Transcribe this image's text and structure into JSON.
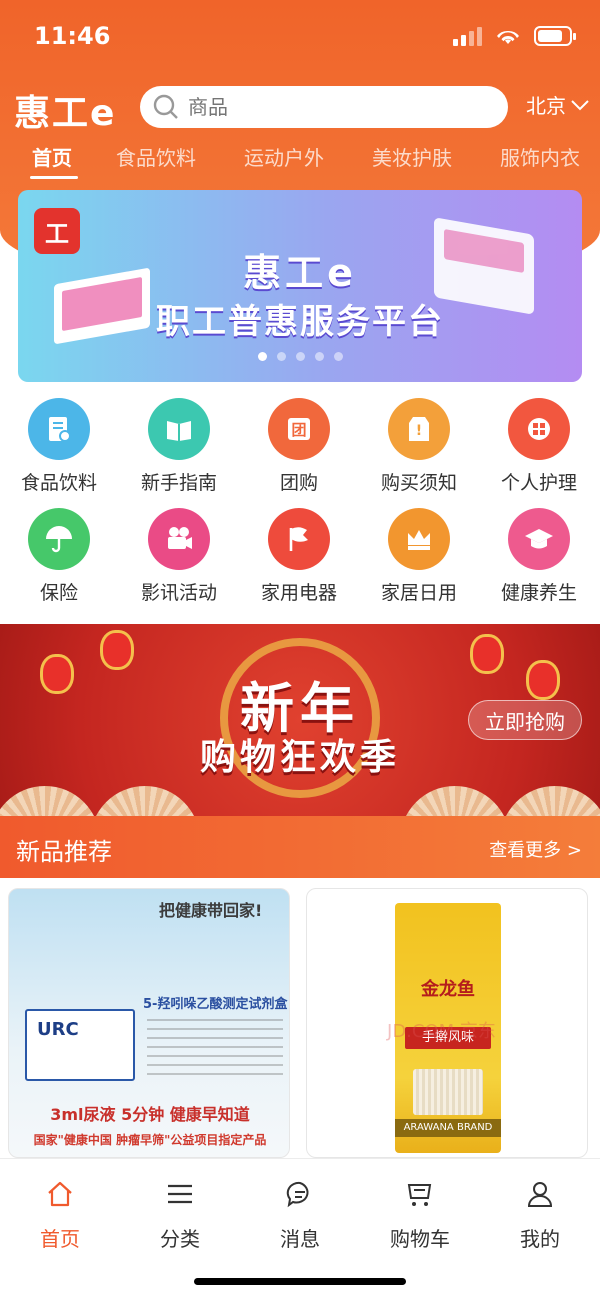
{
  "status_bar": {
    "time": "11:46"
  },
  "header": {
    "logo": "惠工e",
    "search_placeholder": "商品",
    "city": "北京"
  },
  "tabs": [
    {
      "label": "首页",
      "active": true
    },
    {
      "label": "食品饮料"
    },
    {
      "label": "运动户外"
    },
    {
      "label": "美妆护肤"
    },
    {
      "label": "服饰内衣"
    }
  ],
  "hero_banner": {
    "title": "惠工e",
    "subtitle": "职工普惠服务平台",
    "page_count": 5,
    "active_page": 1
  },
  "categories": [
    {
      "label": "食品饮料",
      "icon": "document-certificate-icon",
      "color": "#4cb6e8"
    },
    {
      "label": "新手指南",
      "icon": "book-icon",
      "color": "#3cc8b0"
    },
    {
      "label": "团购",
      "icon": "group-buy-icon",
      "color": "#f1683c"
    },
    {
      "label": "购买须知",
      "icon": "notice-tag-icon",
      "color": "#f3a03a"
    },
    {
      "label": "个人护理",
      "icon": "care-kit-icon",
      "color": "#f2573f"
    },
    {
      "label": "保险",
      "icon": "umbrella-icon",
      "color": "#46c86a"
    },
    {
      "label": "影讯活动",
      "icon": "film-camera-icon",
      "color": "#ea4b86"
    },
    {
      "label": "家用电器",
      "icon": "flag-icon",
      "color": "#ee4b3c"
    },
    {
      "label": "家居日用",
      "icon": "brand-crown-icon",
      "color": "#f2962f"
    },
    {
      "label": "健康养生",
      "icon": "graduation-cap-icon",
      "color": "#ee5a8e"
    }
  ],
  "promo_banner": {
    "line1": "新年",
    "line2": "购物狂欢季",
    "button": "立即抢购"
  },
  "new_products": {
    "title": "新品推荐",
    "more": "查看更多 >",
    "card1": {
      "headline": "把健康带回家!",
      "product_box": "URC",
      "product_name": "5-羟吲哚乙酸测定试剂盒",
      "slogan": "3ml尿液 5分钟 健康早知道",
      "bottom": "国家\"健康中国 肿瘤早筛\"公益项目指定产品"
    },
    "card2": {
      "brand": "金龙鱼",
      "flavor": "手擀风味",
      "footer": "ARAWANA BRAND",
      "watermark": "JD.COM 京东"
    }
  },
  "bottom_nav": [
    {
      "label": "首页",
      "icon": "home-icon",
      "active": true
    },
    {
      "label": "分类",
      "icon": "menu-icon"
    },
    {
      "label": "消息",
      "icon": "message-icon"
    },
    {
      "label": "购物车",
      "icon": "cart-icon"
    },
    {
      "label": "我的",
      "icon": "user-icon"
    }
  ],
  "colors": {
    "accent": "#f05a2d"
  }
}
